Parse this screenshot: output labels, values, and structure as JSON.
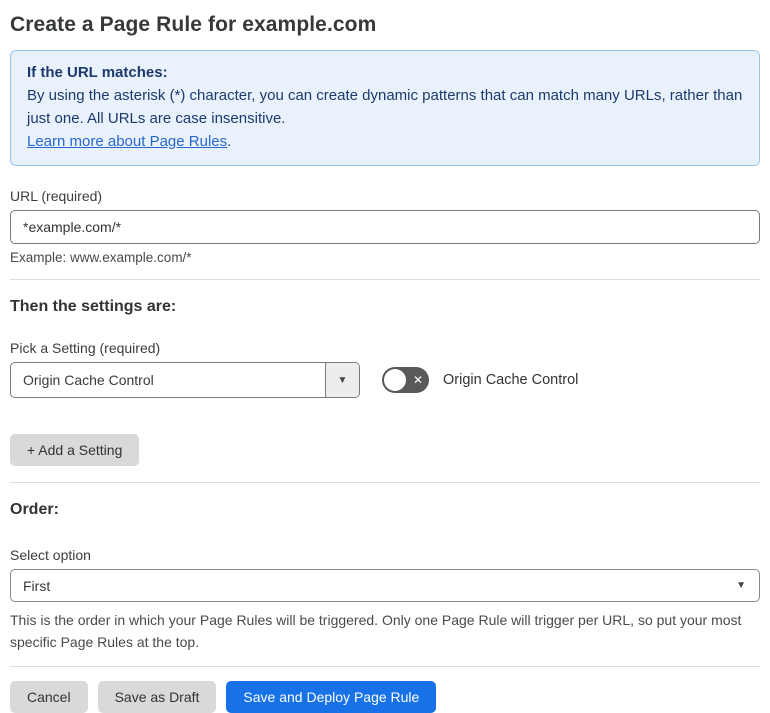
{
  "page": {
    "title": "Create a Page Rule for example.com"
  },
  "info_box": {
    "heading": "If the URL matches:",
    "body": "By using the asterisk (*) character, you can create dynamic patterns that can match many URLs, rather than just one. All URLs are case insensitive.",
    "link": "Learn more about Page Rules",
    "link_suffix": "."
  },
  "url_section": {
    "label": "URL (required)",
    "value": "*example.com/*",
    "helper": "Example: www.example.com/*"
  },
  "settings_section": {
    "heading": "Then the settings are:",
    "picker_label": "Pick a Setting (required)",
    "picker_value": "Origin Cache Control",
    "toggle_label": "Origin Cache Control",
    "toggle_state": "off",
    "add_button_label": "+ Add a Setting"
  },
  "order_section": {
    "heading": "Order:",
    "select_label": "Select option",
    "select_value": "First",
    "helper": "This is the order in which your Page Rules will be triggered. Only one Page Rule will trigger per URL, so put your most specific Page Rules at the top."
  },
  "footer": {
    "cancel_label": "Cancel",
    "save_draft_label": "Save as Draft",
    "save_deploy_label": "Save and Deploy Page Rule"
  },
  "icons": {
    "dropdown_arrow": "▼",
    "toggle_off_x": "✕"
  },
  "colors": {
    "accent_blue": "#1672e6",
    "info_bg": "#e9f2fc",
    "info_border": "#9ec4ec",
    "info_text": "#1d3a6d",
    "link_blue": "#2866cc",
    "toggle_off_bg": "#595959",
    "button_gray": "#d9d9d9"
  }
}
